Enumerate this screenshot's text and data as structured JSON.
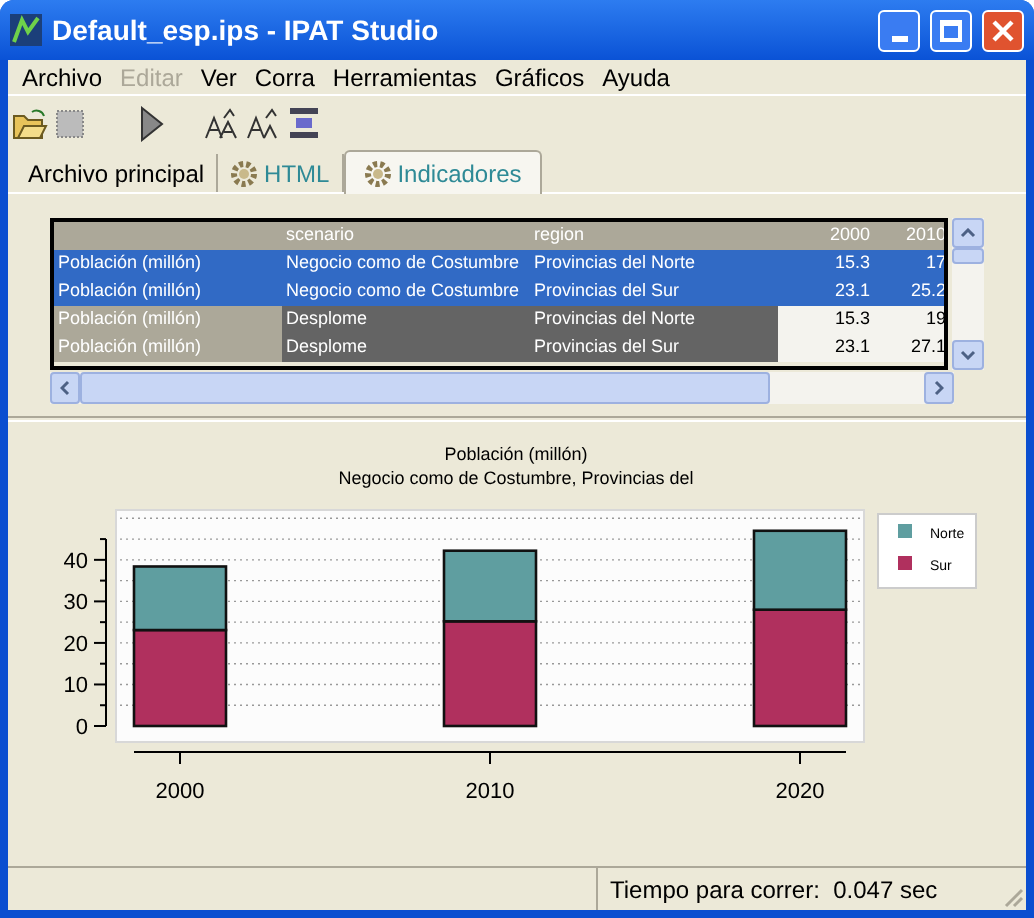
{
  "window": {
    "title": "Default_esp.ips - IPAT Studio"
  },
  "menu": [
    {
      "label": "Archivo",
      "disabled": false
    },
    {
      "label": "Editar",
      "disabled": true
    },
    {
      "label": "Ver",
      "disabled": false
    },
    {
      "label": "Corra",
      "disabled": false
    },
    {
      "label": "Herramientas",
      "disabled": false
    },
    {
      "label": "Gráficos",
      "disabled": false
    },
    {
      "label": "Ayuda",
      "disabled": false
    }
  ],
  "tabs": [
    {
      "label": "Archivo principal",
      "selected": false,
      "icon": false
    },
    {
      "label": "HTML",
      "selected": false,
      "icon": true
    },
    {
      "label": "Indicadores",
      "selected": true,
      "icon": true
    }
  ],
  "table": {
    "columns": [
      "",
      "scenario",
      "region",
      "2000",
      "2010"
    ],
    "rows": [
      {
        "selected": true,
        "cells": [
          "Población (millón)",
          "Negocio como de Costumbre",
          "Provincias del Norte",
          "15.3",
          "17"
        ]
      },
      {
        "selected": true,
        "cells": [
          "Población (millón)",
          "Negocio como de Costumbre",
          "Provincias del Sur",
          "23.1",
          "25.2"
        ]
      },
      {
        "selected": false,
        "cells": [
          "Población (millón)",
          "Desplome",
          "Provincias del Norte",
          "15.3",
          "19"
        ]
      },
      {
        "selected": false,
        "cells": [
          "Población (millón)",
          "Desplome",
          "Provincias del Sur",
          "23.1",
          "27.1"
        ]
      }
    ]
  },
  "chart": {
    "title": "Población (millón)",
    "subtitle": "Negocio como de Costumbre, Provincias del",
    "chart_data": {
      "type": "bar",
      "stacked": true,
      "categories": [
        "2000",
        "2010",
        "2020"
      ],
      "series": [
        {
          "name": "Sur",
          "color": "#b0305e",
          "values": [
            23.1,
            25.2,
            28
          ]
        },
        {
          "name": "Norte",
          "color": "#5f9ea0",
          "values": [
            15.3,
            17,
            19
          ]
        }
      ],
      "ylim": [
        0,
        52
      ],
      "yticks": [
        0,
        10,
        20,
        30,
        40
      ],
      "grid": true,
      "legend": true
    }
  },
  "status_bar": {
    "message": "Tiempo para correr:  0.047 sec"
  }
}
